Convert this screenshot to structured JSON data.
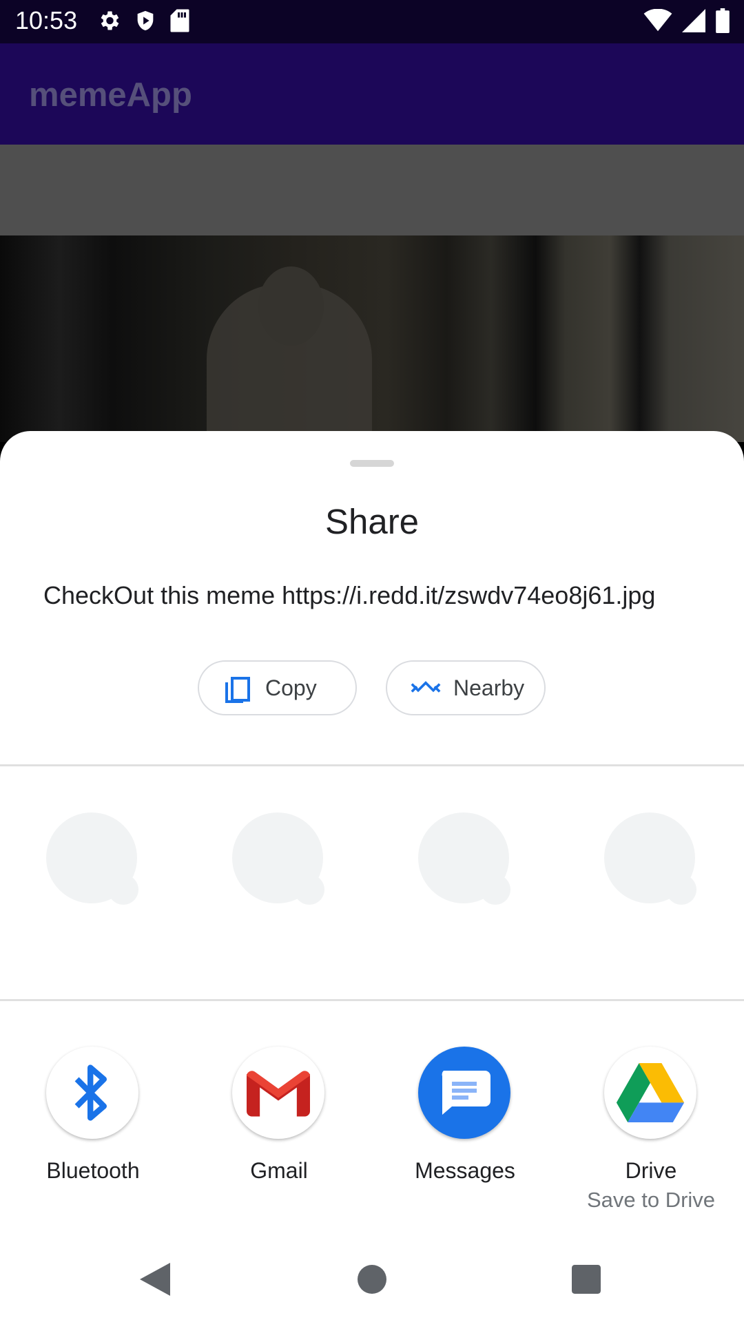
{
  "status_bar": {
    "time": "10:53",
    "left_icons": [
      "gear-icon",
      "shield-icon",
      "sd-card-icon"
    ],
    "right_icons": [
      "wifi-icon",
      "signal-icon",
      "battery-icon"
    ]
  },
  "app_bar": {
    "title": "memeApp"
  },
  "share_sheet": {
    "title": "Share",
    "shared_text": "CheckOut this meme https://i.redd.it/zswdv74eo8j61.jpg",
    "actions": [
      {
        "label": "Copy",
        "icon": "copy-icon"
      },
      {
        "label": "Nearby",
        "icon": "nearby-icon"
      }
    ],
    "apps": [
      {
        "label": "Bluetooth",
        "sublabel": "",
        "icon": "bluetooth-icon"
      },
      {
        "label": "Gmail",
        "sublabel": "",
        "icon": "gmail-icon"
      },
      {
        "label": "Messages",
        "sublabel": "",
        "icon": "messages-icon"
      },
      {
        "label": "Drive",
        "sublabel": "Save to Drive",
        "icon": "drive-icon"
      }
    ]
  },
  "nav_bar": {
    "buttons": [
      "back-icon",
      "home-icon",
      "recents-icon"
    ]
  },
  "colors": {
    "status_bar": "#0c0326",
    "app_bar": "#1c0758",
    "accent_blue": "#1a73e8",
    "placeholder": "#f1f3f4"
  }
}
